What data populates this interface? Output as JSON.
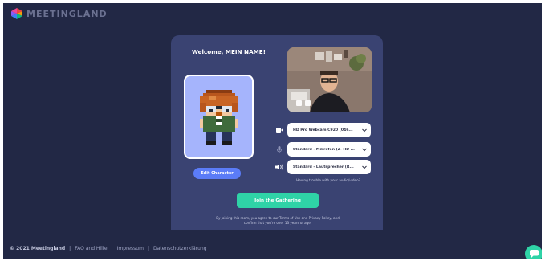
{
  "brand": {
    "name": "MEETINGLAND"
  },
  "card": {
    "welcome": "Welcome, MEIN NAME!",
    "edit_character": "Edit Character",
    "camera": {
      "icon": "video-camera-icon",
      "value": "HD Pro Webcam C920 (046..."
    },
    "microphone": {
      "icon": "microphone-icon",
      "value": "Standard - Mikrofon (2- HD ..."
    },
    "speaker": {
      "icon": "speaker-icon",
      "value": "Standard - Lautsprecher (R..."
    },
    "trouble_link": "Having trouble with your audio/video?",
    "join_button": "Join the Gathering",
    "terms": "By joining this room, you agree to our Terms of Use and Privacy Policy, and confirm that you're over 13 years of age."
  },
  "footer": {
    "copyright": "© 2021 Meetingland",
    "links": [
      "FAQ and Hilfe",
      "Impressum",
      "Datenschutzerklärung"
    ]
  },
  "chat": {
    "icon": "chat-bubble-icon"
  },
  "colors": {
    "background": "#222845",
    "card": "#3a4372",
    "accent_green": "#2fd3a7",
    "accent_blue": "#5b7cf7",
    "avatar_bg": "#a5b4fc"
  }
}
